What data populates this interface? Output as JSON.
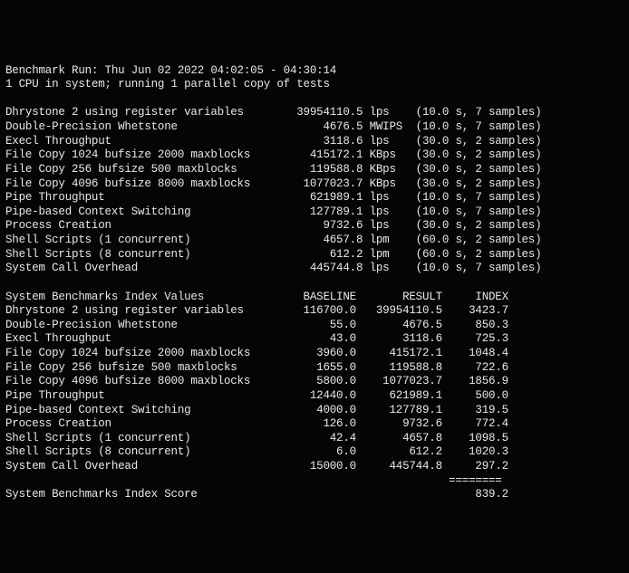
{
  "header": {
    "line1": "Benchmark Run: Thu Jun 02 2022 04:02:05 - 04:30:14",
    "line2": "1 CPU in system; running 1 parallel copy of tests"
  },
  "tests": [
    {
      "name": "Dhrystone 2 using register variables",
      "value": "39954110.5",
      "unit": "lps",
      "timing": "(10.0 s, 7 samples)"
    },
    {
      "name": "Double-Precision Whetstone",
      "value": "4676.5",
      "unit": "MWIPS",
      "timing": "(10.0 s, 7 samples)"
    },
    {
      "name": "Execl Throughput",
      "value": "3118.6",
      "unit": "lps",
      "timing": "(30.0 s, 2 samples)"
    },
    {
      "name": "File Copy 1024 bufsize 2000 maxblocks",
      "value": "415172.1",
      "unit": "KBps",
      "timing": "(30.0 s, 2 samples)"
    },
    {
      "name": "File Copy 256 bufsize 500 maxblocks",
      "value": "119588.8",
      "unit": "KBps",
      "timing": "(30.0 s, 2 samples)"
    },
    {
      "name": "File Copy 4096 bufsize 8000 maxblocks",
      "value": "1077023.7",
      "unit": "KBps",
      "timing": "(30.0 s, 2 samples)"
    },
    {
      "name": "Pipe Throughput",
      "value": "621989.1",
      "unit": "lps",
      "timing": "(10.0 s, 7 samples)"
    },
    {
      "name": "Pipe-based Context Switching",
      "value": "127789.1",
      "unit": "lps",
      "timing": "(10.0 s, 7 samples)"
    },
    {
      "name": "Process Creation",
      "value": "9732.6",
      "unit": "lps",
      "timing": "(30.0 s, 2 samples)"
    },
    {
      "name": "Shell Scripts (1 concurrent)",
      "value": "4657.8",
      "unit": "lpm",
      "timing": "(60.0 s, 2 samples)"
    },
    {
      "name": "Shell Scripts (8 concurrent)",
      "value": "612.2",
      "unit": "lpm",
      "timing": "(60.0 s, 2 samples)"
    },
    {
      "name": "System Call Overhead",
      "value": "445744.8",
      "unit": "lps",
      "timing": "(10.0 s, 7 samples)"
    }
  ],
  "index_section": {
    "header": {
      "label": "System Benchmarks Index Values",
      "c1": "BASELINE",
      "c2": "RESULT",
      "c3": "INDEX"
    },
    "rows": [
      {
        "name": "Dhrystone 2 using register variables",
        "baseline": "116700.0",
        "result": "39954110.5",
        "index": "3423.7"
      },
      {
        "name": "Double-Precision Whetstone",
        "baseline": "55.0",
        "result": "4676.5",
        "index": "850.3"
      },
      {
        "name": "Execl Throughput",
        "baseline": "43.0",
        "result": "3118.6",
        "index": "725.3"
      },
      {
        "name": "File Copy 1024 bufsize 2000 maxblocks",
        "baseline": "3960.0",
        "result": "415172.1",
        "index": "1048.4"
      },
      {
        "name": "File Copy 256 bufsize 500 maxblocks",
        "baseline": "1655.0",
        "result": "119588.8",
        "index": "722.6"
      },
      {
        "name": "File Copy 4096 bufsize 8000 maxblocks",
        "baseline": "5800.0",
        "result": "1077023.7",
        "index": "1856.9"
      },
      {
        "name": "Pipe Throughput",
        "baseline": "12440.0",
        "result": "621989.1",
        "index": "500.0"
      },
      {
        "name": "Pipe-based Context Switching",
        "baseline": "4000.0",
        "result": "127789.1",
        "index": "319.5"
      },
      {
        "name": "Process Creation",
        "baseline": "126.0",
        "result": "9732.6",
        "index": "772.4"
      },
      {
        "name": "Shell Scripts (1 concurrent)",
        "baseline": "42.4",
        "result": "4657.8",
        "index": "1098.5"
      },
      {
        "name": "Shell Scripts (8 concurrent)",
        "baseline": "6.0",
        "result": "612.2",
        "index": "1020.3"
      },
      {
        "name": "System Call Overhead",
        "baseline": "15000.0",
        "result": "445744.8",
        "index": "297.2"
      }
    ],
    "divider": "                                                                   ========",
    "score": {
      "label": "System Benchmarks Index Score",
      "value": "839.2"
    }
  }
}
